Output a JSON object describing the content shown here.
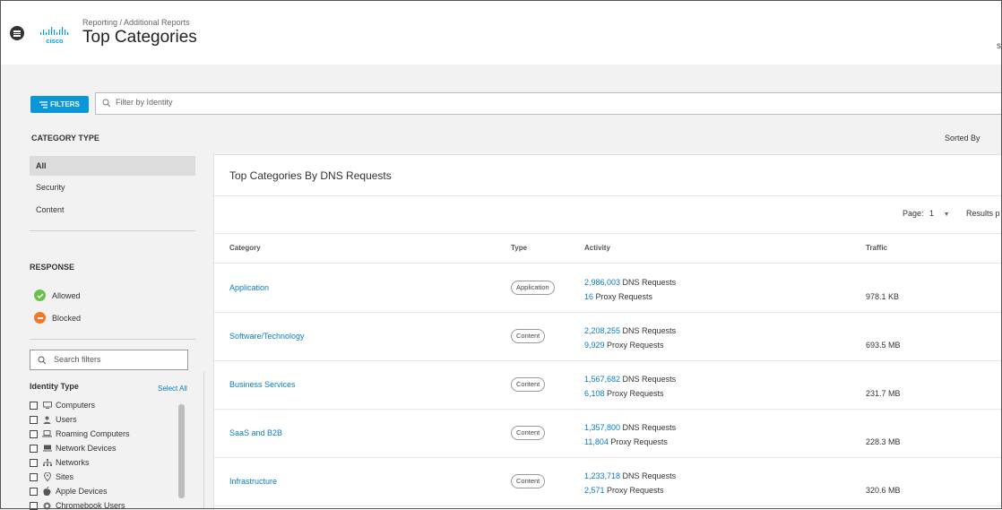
{
  "header": {
    "breadcrumb": "Reporting / Additional Reports",
    "title": "Top Categories",
    "edge_letter": "s"
  },
  "filters": {
    "button_label": "FILTERS",
    "search_placeholder": "Filter by Identity"
  },
  "category_type": {
    "heading": "CATEGORY TYPE",
    "items": [
      {
        "label": "All",
        "active": true
      },
      {
        "label": "Security",
        "active": false
      },
      {
        "label": "Content",
        "active": false
      }
    ]
  },
  "sorted_by": "Sorted By",
  "response": {
    "heading": "RESPONSE",
    "items": [
      {
        "label": "Allowed",
        "color": "#6cc04a"
      },
      {
        "label": "Blocked",
        "color": "#f0782b"
      }
    ]
  },
  "search_filters": {
    "placeholder": "Search filters"
  },
  "identity_type": {
    "heading": "Identity Type",
    "select_all": "Select All",
    "items": [
      {
        "label": "Computers",
        "icon": "monitor-icon"
      },
      {
        "label": "Users",
        "icon": "user-icon"
      },
      {
        "label": "Roaming Computers",
        "icon": "laptop-icon"
      },
      {
        "label": "Network Devices",
        "icon": "network-device-icon"
      },
      {
        "label": "Networks",
        "icon": "network-icon"
      },
      {
        "label": "Sites",
        "icon": "location-pin-icon"
      },
      {
        "label": "Apple Devices",
        "icon": "apple-icon"
      },
      {
        "label": "Chromebook Users",
        "icon": "chrome-icon"
      }
    ]
  },
  "main": {
    "card_title": "Top Categories By DNS Requests",
    "page_label": "Page:",
    "page_value": "1",
    "results_label": "Results p",
    "columns": {
      "category": "Category",
      "type": "Type",
      "activity": "Activity",
      "traffic": "Traffic"
    },
    "dns_suffix": " DNS Requests",
    "proxy_suffix": " Proxy Requests",
    "rows": [
      {
        "category": "Application",
        "type": "Application",
        "dns": "2,986,003",
        "proxy": "16",
        "traffic": "978.1 KB"
      },
      {
        "category": "Software/Technology",
        "type": "Content",
        "dns": "2,208,255",
        "proxy": "9,929",
        "traffic": "693.5 MB"
      },
      {
        "category": "Business Services",
        "type": "Content",
        "dns": "1,567,682",
        "proxy": "6,108",
        "traffic": "231.7 MB"
      },
      {
        "category": "SaaS and B2B",
        "type": "Content",
        "dns": "1,357,800",
        "proxy": "11,804",
        "traffic": "228.3 MB"
      },
      {
        "category": "Infrastructure",
        "type": "Content",
        "dns": "1,233,718",
        "proxy": "2,571",
        "traffic": "320.6 MB"
      }
    ]
  },
  "colors": {
    "accent": "#0a97d9",
    "link": "#0a7cc4"
  }
}
